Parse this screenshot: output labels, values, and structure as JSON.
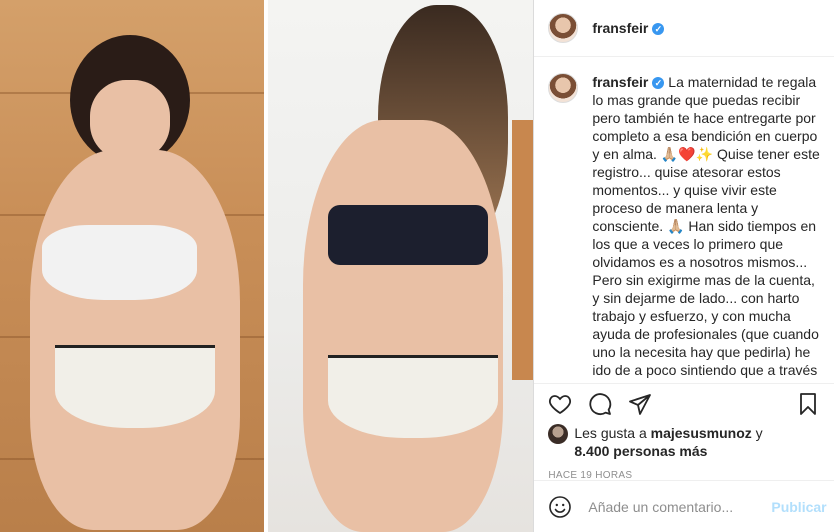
{
  "header": {
    "username": "fransfeir",
    "verified_mark": "✓"
  },
  "caption": {
    "username": "fransfeir",
    "verified_mark": "✓",
    "text": "La maternidad te regala lo mas grande que puedas recibir pero también te hace entregarte por completo a esa bendición en cuerpo y en alma. 🙏🏼❤️✨ Quise tener este registro... quise atesorar estos momentos... y quise vivir este proceso de manera lenta y consciente. 🙏🏼 Han sido tiempos en los que a veces lo primero que olvidamos es a nosotros mismos... Pero sin exigirme mas de la cuenta, y sin dejarme de lado... con harto trabajo y esfuerzo, y con mucha ayuda de profesionales (que cuando uno la necesita hay que pedirla) he ido de a poco sintiendo que a través de mi cuerpo se refleja como cada parte de mí va volviendo a su lugar, recuperando su esencia y..."
  },
  "actions": {
    "icons": [
      "heart-icon",
      "comment-icon",
      "share-icon",
      "bookmark-icon"
    ]
  },
  "likes": {
    "prefix": "Les gusta a",
    "user": "majesusmunoz",
    "connector": "y",
    "count": "8.400 personas más"
  },
  "timestamp": "HACE 19 HORAS",
  "comment": {
    "placeholder": "Añade un comentario...",
    "publish_label": "Publicar",
    "emoji_icon": "smiley-icon"
  },
  "colors": {
    "verified": "#3897f0",
    "publish_disabled": "#b2dffc",
    "timestamp": "#8e8e8e"
  }
}
